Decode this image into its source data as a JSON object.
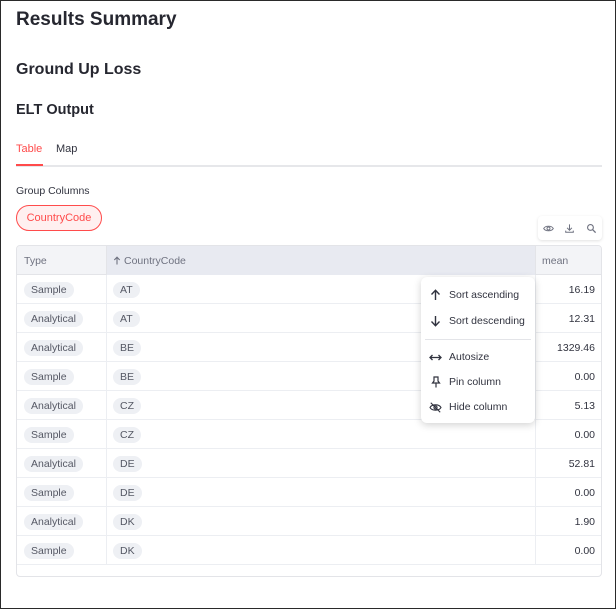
{
  "header": {
    "title": "Results Summary",
    "subtitle": "Ground Up Loss",
    "section": "ELT Output"
  },
  "tabs": [
    {
      "label": "Table",
      "active": true
    },
    {
      "label": "Map",
      "active": false
    }
  ],
  "group_columns": {
    "label": "Group Columns",
    "chips": [
      "CountryCode"
    ]
  },
  "toolbar": {
    "icons": [
      "eye-icon",
      "download-icon",
      "search-icon"
    ]
  },
  "grid": {
    "columns": [
      {
        "label": "Type"
      },
      {
        "label": "CountryCode",
        "sort": "ascending"
      },
      {
        "label": "mean"
      }
    ],
    "rows": [
      {
        "type": "Sample",
        "country": "AT",
        "mean": "16.19"
      },
      {
        "type": "Analytical",
        "country": "AT",
        "mean": "12.31"
      },
      {
        "type": "Analytical",
        "country": "BE",
        "mean": "1329.46"
      },
      {
        "type": "Sample",
        "country": "BE",
        "mean": "0.00"
      },
      {
        "type": "Analytical",
        "country": "CZ",
        "mean": "5.13"
      },
      {
        "type": "Sample",
        "country": "CZ",
        "mean": "0.00"
      },
      {
        "type": "Analytical",
        "country": "DE",
        "mean": "52.81"
      },
      {
        "type": "Sample",
        "country": "DE",
        "mean": "0.00"
      },
      {
        "type": "Analytical",
        "country": "DK",
        "mean": "1.90"
      },
      {
        "type": "Sample",
        "country": "DK",
        "mean": "0.00"
      }
    ]
  },
  "column_menu": {
    "items": [
      {
        "label": "Sort ascending",
        "icon": "arrow-up-icon"
      },
      {
        "label": "Sort descending",
        "icon": "arrow-down-icon"
      },
      {
        "label": "Autosize",
        "icon": "autosize-icon"
      },
      {
        "label": "Pin column",
        "icon": "pin-icon"
      },
      {
        "label": "Hide column",
        "icon": "eye-off-icon"
      }
    ]
  },
  "colors": {
    "accent": "#ff4b4b",
    "text": "#31333f",
    "header_bg": "#f3f4f7"
  }
}
